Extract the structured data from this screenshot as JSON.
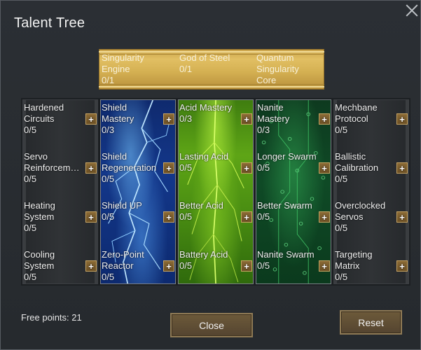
{
  "window": {
    "title": "Talent Tree"
  },
  "ultimate": [
    {
      "name": "Singularity\nEngine",
      "rank": "0/1"
    },
    {
      "name": "God of Steel",
      "rank": "0/1"
    },
    {
      "name": "Quantum\nSingularity\nCore",
      "rank": ""
    }
  ],
  "columns": [
    {
      "theme": "plain",
      "talents": [
        {
          "name": "Hardened\nCircuits",
          "rank": "0/5"
        },
        {
          "name": "Servo\nReinforcem…",
          "rank": "0/5"
        },
        {
          "name": "Heating\nSystem",
          "rank": "0/5"
        },
        {
          "name": "Cooling\nSystem",
          "rank": "0/5"
        }
      ]
    },
    {
      "theme": "lightning",
      "talents": [
        {
          "name": "Shield\nMastery",
          "rank": "0/3"
        },
        {
          "name": "Shield\nRegeneration",
          "rank": "0/5"
        },
        {
          "name": "Shield UP",
          "rank": "0/5"
        },
        {
          "name": "Zero-Point\nReactor",
          "rank": "0/5"
        }
      ]
    },
    {
      "theme": "acid",
      "talents": [
        {
          "name": "Acid Mastery",
          "rank": "0/3"
        },
        {
          "name": "Lasting Acid",
          "rank": "0/5"
        },
        {
          "name": "Better Acid",
          "rank": "0/5"
        },
        {
          "name": "Battery Acid",
          "rank": "0/5"
        }
      ]
    },
    {
      "theme": "swarm",
      "talents": [
        {
          "name": "Nanite\nMastery",
          "rank": "0/3"
        },
        {
          "name": "Longer Swarm",
          "rank": "0/5"
        },
        {
          "name": "Better Swarm",
          "rank": "0/5"
        },
        {
          "name": "Nanite Swarm",
          "rank": "0/5"
        }
      ]
    },
    {
      "theme": "plain",
      "talents": [
        {
          "name": "Mechbane\nProtocol",
          "rank": "0/5"
        },
        {
          "name": "Ballistic\nCalibration",
          "rank": "0/5"
        },
        {
          "name": "Overclocked\nServos",
          "rank": "0/5"
        },
        {
          "name": "Targeting\nMatrix",
          "rank": "0/5"
        }
      ]
    }
  ],
  "plus_label": "+",
  "footer": {
    "free_points": "Free points: 21",
    "close_label": "Close",
    "reset_label": "Reset"
  },
  "colors": {
    "gold": "#d5b153",
    "button": "#6d5a3a",
    "lightning": "#13378a",
    "acid": "#5ea516",
    "swarm": "#0f4a26"
  }
}
